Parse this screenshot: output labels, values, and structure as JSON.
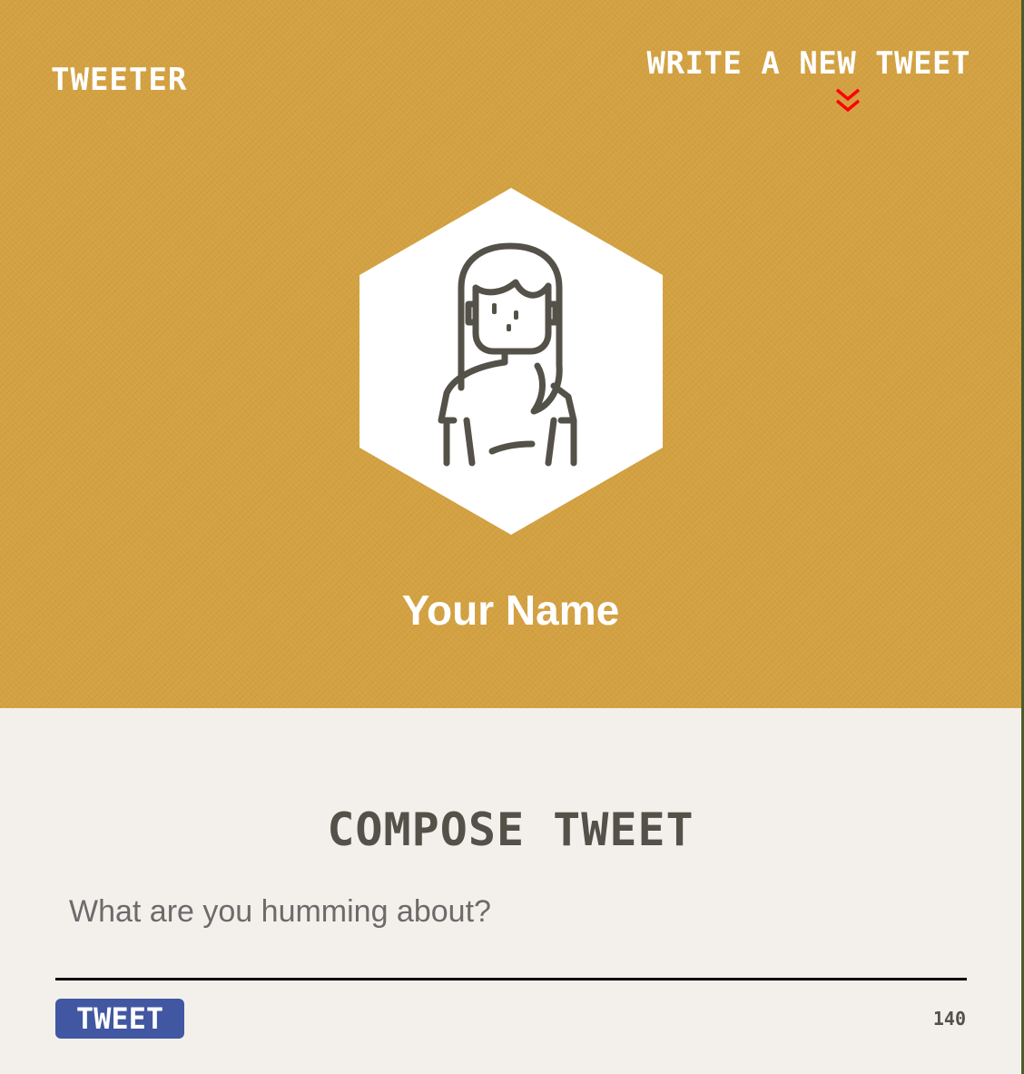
{
  "nav": {
    "brand": "TWEETER",
    "write_link": "WRITE A NEW TWEET",
    "chevron_icon": "double-chevron-down-icon",
    "chevron_color": "#ff0000"
  },
  "profile": {
    "name": "Your Name",
    "avatar_icon": "user-avatar-icon",
    "header_color": "#d3a141"
  },
  "compose": {
    "title": "COMPOSE TWEET",
    "placeholder": "What are you humming about?",
    "value": "",
    "button_label": "TWEET",
    "button_color": "#4157a2",
    "counter": "140"
  }
}
